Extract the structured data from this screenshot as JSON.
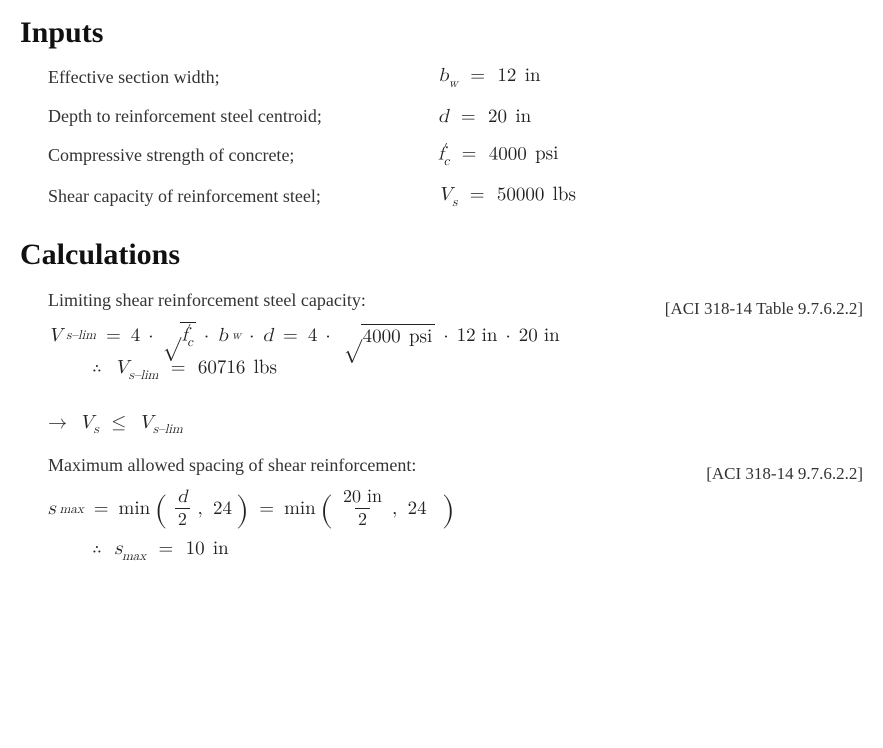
{
  "sections": {
    "inputs_title": "Inputs",
    "calculations_title": "Calculations"
  },
  "inputs": [
    {
      "desc": "Effective section width;",
      "sym_html": "b<sub class='sub math'>w</sub>",
      "val": "12",
      "unit": "in"
    },
    {
      "desc": "Depth to reinforcement steel centroid;",
      "sym_html": "d",
      "val": "20",
      "unit": "in"
    },
    {
      "desc": "Compressive strength of concrete;",
      "sym_html": "f<span class='sup'>′</span><sub class='sub math'>c</sub>",
      "val": "4000",
      "unit": "psi"
    },
    {
      "desc": "Shear capacity of reinforcement steel;",
      "sym_html": "V<sub class='sub math'>s</sub>",
      "val": "50000",
      "unit": "lbs"
    }
  ],
  "calc": {
    "limiting_text": "Limiting shear reinforcement steel capacity:",
    "ref1": "[ACI 318-14 Table 9.7.6.2.2]",
    "vs_lim_coeff": "4",
    "fc_val": "4000",
    "fc_unit": "psi",
    "bw_val": "12",
    "bw_unit": "in",
    "d_val": "20",
    "d_unit": "in",
    "vslim_result": "60716",
    "vslim_unit": "lbs",
    "cond_text_relation": "≤",
    "max_spacing_text": "Maximum allowed spacing of shear reinforcement:",
    "ref2": "[ACI 318-14 9.7.6.2.2]",
    "smax_min_items_sym": {
      "dhalf_num": "d",
      "dhalf_den": "2",
      "const": "24"
    },
    "smax_min_items_num": {
      "num": "20 in",
      "den": "2",
      "const": "24"
    },
    "smax_result": "10",
    "smax_unit": "in"
  }
}
